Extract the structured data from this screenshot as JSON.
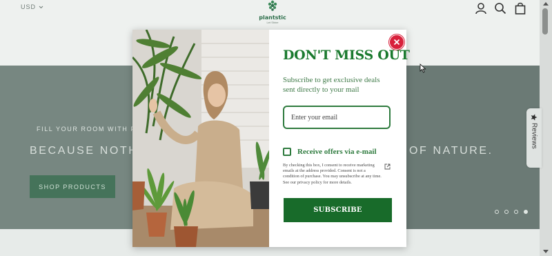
{
  "header": {
    "currency": "USD",
    "logo": {
      "name": "plantstic",
      "tagline": "Let Shine"
    },
    "icons": [
      "account-icon",
      "search-icon",
      "cart-icon"
    ]
  },
  "hero": {
    "tagline_visible": "FILL YOUR ROOM WITH PLA",
    "title_left": "BECAUSE NOTHI",
    "title_right": "OF NATURE.",
    "cta_label": "SHOP PRODUCTS",
    "slides_total": 4,
    "active_slide": 4
  },
  "reviews_tab": {
    "label": "Reviews"
  },
  "popup": {
    "title": "DON'T MISS OUT",
    "subtitle": "Subscribe to get exclusive deals sent directly to your mail",
    "email_placeholder": "Enter your email",
    "checkbox_label": "Receive offers via e-mail",
    "consent_text": "By checking this box, I consent to receive marketing emails at the address provided. Consent is not a condition of purchase. You may unsubscribe at any time. See our privacy policy for more details.",
    "subscribe_label": "SUBSCRIBE"
  },
  "colors": {
    "brand_green": "#1b7a2f",
    "button_green": "#186b2a",
    "close_red": "#d8203b"
  }
}
